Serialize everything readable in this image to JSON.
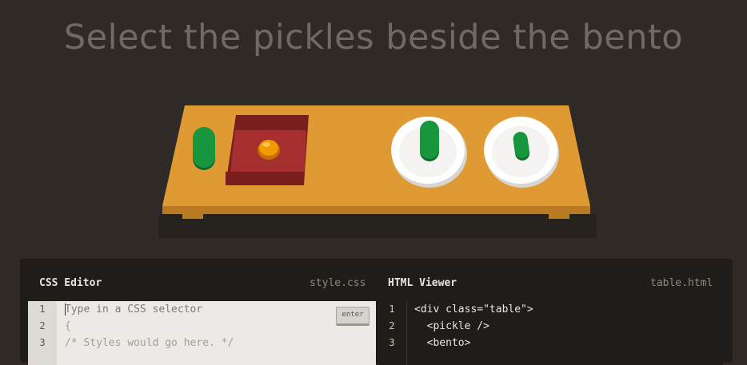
{
  "instruction": "Select the pickles beside the bento",
  "css_editor": {
    "title": "CSS Editor",
    "filename": "style.css",
    "line_numbers": [
      "1",
      "2",
      "3"
    ],
    "input_placeholder": "Type in a CSS selector",
    "enter_label": "enter",
    "line2": "{",
    "line3": "/* Styles would go here. */"
  },
  "html_viewer": {
    "title": "HTML Viewer",
    "filename": "table.html",
    "line_numbers": [
      "1",
      "2",
      "3"
    ],
    "lines": [
      "<div class=\"table\">",
      "  <pickle />",
      "  <bento>"
    ]
  },
  "colors": {
    "background": "#2f2a25",
    "table": "#df9a33",
    "pickle": "#17963d",
    "bento": "#9c2b2b",
    "plate": "#ffffff",
    "orange": "#f29b00"
  },
  "table_items": [
    "pickle",
    "bento-with-orange",
    "plate-with-pickle",
    "plate-with-pickle"
  ]
}
